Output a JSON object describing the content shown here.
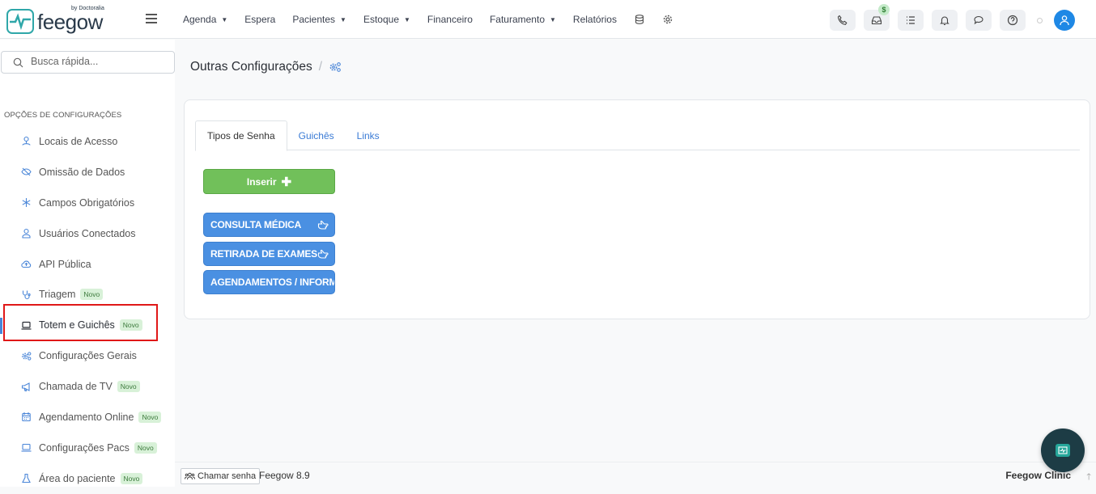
{
  "brand": {
    "name": "feegow",
    "byline": "by Doctoralia"
  },
  "nav": {
    "items": [
      {
        "label": "Agenda",
        "dropdown": true
      },
      {
        "label": "Espera",
        "dropdown": false
      },
      {
        "label": "Pacientes",
        "dropdown": true
      },
      {
        "label": "Estoque",
        "dropdown": true
      },
      {
        "label": "Financeiro",
        "dropdown": false
      },
      {
        "label": "Faturamento",
        "dropdown": true
      },
      {
        "label": "Relatórios",
        "dropdown": false
      }
    ],
    "extra_icons": [
      "database-icon",
      "gear-icon"
    ]
  },
  "toolbar": {
    "icons": [
      "phone-icon",
      "inbox-icon",
      "checklist-icon",
      "bell-icon",
      "chat-icon",
      "help-icon"
    ],
    "inbox_badge": "$"
  },
  "sidebar": {
    "search_placeholder": "Busca rápida...",
    "section_title": "OPÇÕES DE CONFIGURAÇÕES",
    "items": [
      {
        "label": "Locais de Acesso",
        "icon": "location-icon",
        "novo": false
      },
      {
        "label": "Omissão de Dados",
        "icon": "eye-off-icon",
        "novo": false
      },
      {
        "label": "Campos Obrigatórios",
        "icon": "asterisk-icon",
        "novo": false
      },
      {
        "label": "Usuários Conectados",
        "icon": "user-icon",
        "novo": false
      },
      {
        "label": "API Pública",
        "icon": "cloud-upload-icon",
        "novo": false
      },
      {
        "label": "Triagem",
        "icon": "stethoscope-icon",
        "novo": true
      },
      {
        "label": "Totem e Guichês",
        "icon": "laptop-icon",
        "novo": true,
        "active": true
      },
      {
        "label": "Configurações Gerais",
        "icon": "gears-icon",
        "novo": false
      },
      {
        "label": "Chamada de TV",
        "icon": "megaphone-icon",
        "novo": true
      },
      {
        "label": "Agendamento Online",
        "icon": "calendar-icon",
        "novo": true
      },
      {
        "label": "Configurações Pacs",
        "icon": "laptop-icon",
        "novo": true
      },
      {
        "label": "Área do paciente",
        "icon": "flask-icon",
        "novo": true
      }
    ],
    "novo_label": "Novo"
  },
  "page": {
    "title": "Outras Configurações",
    "separator": "/",
    "tabs": [
      "Tipos de Senha",
      "Guichês",
      "Links"
    ],
    "active_tab": 0,
    "insert_label": "Inserir",
    "tipos": [
      "CONSULTA MÉDICA",
      "RETIRADA DE EXAMES",
      "AGENDAMENTOS / INFORMAÇÕES"
    ]
  },
  "footer": {
    "chamar_label": "Chamar senha",
    "version": "Feegow 8.9",
    "brand": "Feegow Clinic"
  },
  "colors": {
    "accent": "#4a90e2",
    "insert_green": "#71c05a",
    "highlight_red": "#e01818",
    "novo_bg": "#d8f1d8"
  }
}
